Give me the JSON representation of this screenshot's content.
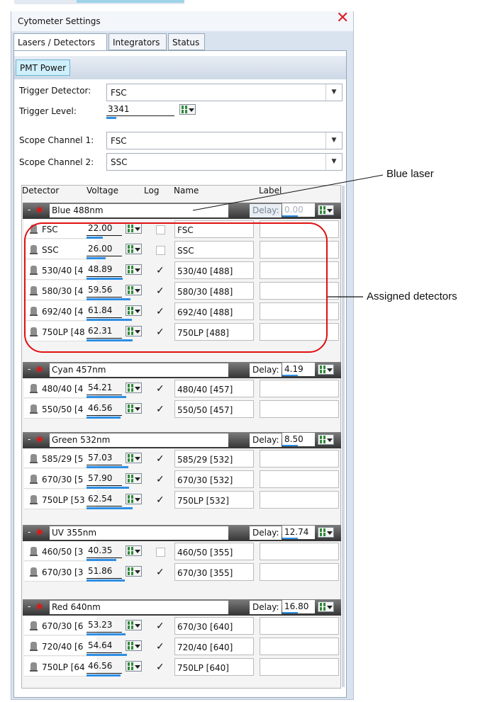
{
  "window": {
    "title": "Cytometer Settings"
  },
  "tabs": [
    {
      "label": "Lasers / Detectors"
    },
    {
      "label": "Integrators"
    },
    {
      "label": "Status"
    }
  ],
  "toolbar": {
    "pmt_power": "PMT Power"
  },
  "trigger": {
    "detector_label": "Trigger Detector:",
    "detector_value": "FSC",
    "level_label": "Trigger Level:",
    "level_value": "3341"
  },
  "scope": {
    "ch1_label": "Scope Channel 1:",
    "ch1_value": "FSC",
    "ch2_label": "Scope Channel 2:",
    "ch2_value": "SSC"
  },
  "columns": {
    "detector": "Detector",
    "voltage": "Voltage",
    "log": "Log",
    "name": "Name",
    "label": "Label"
  },
  "delay_label": "Delay:",
  "lasers": [
    {
      "name": "Blue 488nm",
      "delay": "0.00",
      "delay_enabled": false,
      "detectors": [
        {
          "det": "FSC",
          "voltage": "22.00",
          "log": false,
          "name": "FSC",
          "label": ""
        },
        {
          "det": "SSC",
          "voltage": "26.00",
          "log": false,
          "name": "SSC",
          "label": ""
        },
        {
          "det": "530/40 [4",
          "voltage": "48.89",
          "log": true,
          "name": "530/40 [488]",
          "label": ""
        },
        {
          "det": "580/30 [4",
          "voltage": "59.56",
          "log": true,
          "name": "580/30 [488]",
          "label": ""
        },
        {
          "det": "692/40 [4",
          "voltage": "61.84",
          "log": true,
          "name": "692/40 [488]",
          "label": ""
        },
        {
          "det": "750LP [48",
          "voltage": "62.31",
          "log": true,
          "name": "750LP [488]",
          "label": ""
        }
      ]
    },
    {
      "name": "Cyan 457nm",
      "delay": "4.19",
      "delay_enabled": true,
      "detectors": [
        {
          "det": "480/40 [4",
          "voltage": "54.21",
          "log": true,
          "name": "480/40 [457]",
          "label": ""
        },
        {
          "det": "550/50 [4",
          "voltage": "46.56",
          "log": true,
          "name": "550/50 [457]",
          "label": ""
        }
      ]
    },
    {
      "name": "Green 532nm",
      "delay": "8.50",
      "delay_enabled": true,
      "detectors": [
        {
          "det": "585/29 [5",
          "voltage": "57.03",
          "log": true,
          "name": "585/29 [532]",
          "label": ""
        },
        {
          "det": "670/30 [5",
          "voltage": "57.90",
          "log": true,
          "name": "670/30 [532]",
          "label": ""
        },
        {
          "det": "750LP [53",
          "voltage": "62.54",
          "log": true,
          "name": "750LP [532]",
          "label": ""
        }
      ]
    },
    {
      "name": "UV 355nm",
      "delay": "12.74",
      "delay_enabled": true,
      "detectors": [
        {
          "det": "460/50 [3",
          "voltage": "40.35",
          "log": false,
          "name": "460/50 [355]",
          "label": ""
        },
        {
          "det": "670/30 [3",
          "voltage": "51.86",
          "log": true,
          "name": "670/30 [355]",
          "label": ""
        }
      ]
    },
    {
      "name": "Red 640nm",
      "delay": "16.80",
      "delay_enabled": true,
      "detectors": [
        {
          "det": "670/30 [6",
          "voltage": "53.23",
          "log": true,
          "name": "670/30 [640]",
          "label": ""
        },
        {
          "det": "720/40 [6",
          "voltage": "54.64",
          "log": true,
          "name": "720/40 [640]",
          "label": ""
        },
        {
          "det": "750LP [64",
          "voltage": "46.56",
          "log": true,
          "name": "750LP [640]",
          "label": ""
        }
      ]
    }
  ],
  "annotations": {
    "blue_laser": "Blue laser",
    "assigned": "Assigned detectors"
  },
  "colors": {
    "accent": "#2d8ee3",
    "close": "#d9232e",
    "annotation_oval": "#e01010"
  }
}
